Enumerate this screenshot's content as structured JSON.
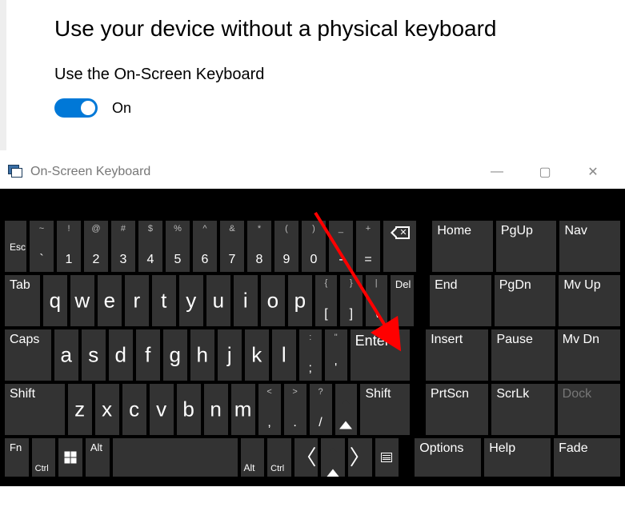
{
  "settings": {
    "title": "Use your device without a physical keyboard",
    "subhead": "Use the On-Screen Keyboard",
    "toggle_state": "On"
  },
  "window": {
    "title": "On-Screen Keyboard",
    "minimize": "—",
    "maximize": "▢",
    "close": "✕"
  },
  "row1": {
    "esc": "Esc",
    "keys": [
      {
        "sup": "~",
        "sub": "`"
      },
      {
        "sup": "!",
        "sub": "1"
      },
      {
        "sup": "@",
        "sub": "2"
      },
      {
        "sup": "#",
        "sub": "3"
      },
      {
        "sup": "$",
        "sub": "4"
      },
      {
        "sup": "%",
        "sub": "5"
      },
      {
        "sup": "^",
        "sub": "6"
      },
      {
        "sup": "&",
        "sub": "7"
      },
      {
        "sup": "*",
        "sub": "8"
      },
      {
        "sup": "(",
        "sub": "9"
      },
      {
        "sup": ")",
        "sub": "0"
      },
      {
        "sup": "_",
        "sub": "-"
      },
      {
        "sup": "+",
        "sub": "="
      }
    ]
  },
  "row2": {
    "tab": "Tab",
    "keys": [
      "q",
      "w",
      "e",
      "r",
      "t",
      "y",
      "u",
      "i",
      "o",
      "p"
    ],
    "br1": {
      "sup": "{",
      "sub": "["
    },
    "br2": {
      "sup": "}",
      "sub": "]"
    },
    "bs": {
      "sup": "|",
      "sub": "\\"
    },
    "del": "Del"
  },
  "row3": {
    "caps": "Caps",
    "keys": [
      "a",
      "s",
      "d",
      "f",
      "g",
      "h",
      "j",
      "k",
      "l"
    ],
    "semi": {
      "sup": ":",
      "sub": ";"
    },
    "quote": {
      "sup": "\"",
      "sub": "'"
    },
    "enter": "Enter"
  },
  "row4": {
    "lshift": "Shift",
    "keys": [
      "z",
      "x",
      "c",
      "v",
      "b",
      "n",
      "m"
    ],
    "comma": {
      "sup": "<",
      "sub": ","
    },
    "period": {
      "sup": ">",
      "sub": "."
    },
    "slash": {
      "sup": "?",
      "sub": "/"
    },
    "rshift": "Shift"
  },
  "row5": {
    "fn": "Fn",
    "ctrl": "Ctrl",
    "alt": "Alt",
    "altr": "Alt",
    "ctrlr": "Ctrl"
  },
  "nav": {
    "r1": [
      "Home",
      "PgUp",
      "Nav"
    ],
    "r2": [
      "End",
      "PgDn",
      "Mv Up"
    ],
    "r3": [
      "Insert",
      "Pause",
      "Mv Dn"
    ],
    "r4": [
      "PrtScn",
      "ScrLk",
      "Dock"
    ],
    "r5": [
      "Options",
      "Help",
      "Fade"
    ]
  }
}
